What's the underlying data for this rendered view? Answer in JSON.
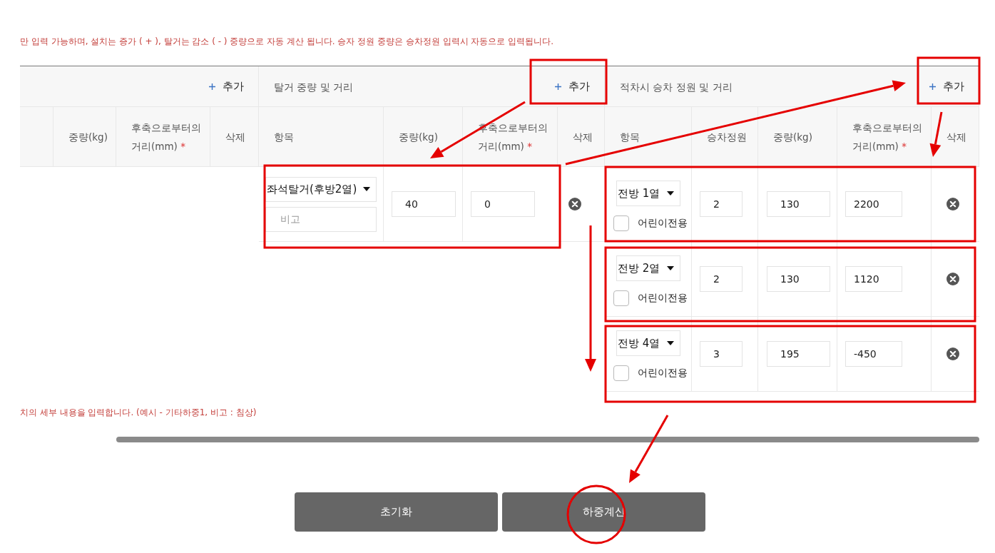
{
  "top_notice": "만 입력 가능하며, 설치는 증가 ( + ), 탈거는 감소 ( - ) 중량으로 자동 계산 됩니다. 승자 정원 중량은 승차정원 입력시 자동으로 입력됩니다.",
  "table": {
    "sections": [
      {
        "kind": "plain",
        "add_button": "추가",
        "columns": [
          {
            "kind": "blank"
          },
          {
            "kind": "text",
            "label": "중량(kg)"
          },
          {
            "kind": "text",
            "label": "후축으로부터의 거리(mm)",
            "mark": "*"
          },
          {
            "kind": "text",
            "label": "삭제"
          }
        ]
      },
      {
        "kind": "removal",
        "title": "탈거 중량 및 거리",
        "add_button": "추가",
        "columns": [
          {
            "kind": "text",
            "label": "항목"
          },
          {
            "kind": "text",
            "label": "중량(kg)"
          },
          {
            "kind": "text",
            "label": "후축으로부터의 거리(mm)",
            "mark": "*"
          },
          {
            "kind": "text",
            "label": "삭제"
          }
        ],
        "rows": [
          {
            "item": "좌석탈거(후방2열)",
            "note_placeholder": "비고",
            "weight": "40",
            "distance": "0"
          }
        ]
      },
      {
        "kind": "passenger",
        "title": "적차시 승차 정원 및 거리",
        "add_button": "추가",
        "columns": [
          {
            "kind": "text",
            "label": "항목"
          },
          {
            "kind": "text",
            "label": "승차정원"
          },
          {
            "kind": "text",
            "label": "중량(kg)"
          },
          {
            "kind": "text",
            "label": "후축으로부터의 거리(mm)",
            "mark": "*"
          },
          {
            "kind": "text",
            "label": "삭제"
          }
        ],
        "rows": [
          {
            "seat": "전방 1열",
            "child_only": {
              "label": "어린이전용",
              "checked": false
            },
            "passengers": "2",
            "weight": "130",
            "distance": "2200"
          },
          {
            "seat": "전방 2열",
            "child_only": {
              "label": "어린이전용",
              "checked": false
            },
            "passengers": "2",
            "weight": "130",
            "distance": "1120"
          },
          {
            "seat": "전방 4열",
            "child_only": {
              "label": "어린이전용",
              "checked": false
            },
            "passengers": "3",
            "weight": "195",
            "distance": "-450"
          }
        ]
      }
    ]
  },
  "bottom_notice": "치의 세부 내용을 입력합니다. (예시 - 기타하중1, 비고 : 침상)",
  "buttons": [
    {
      "label": "초기화"
    },
    {
      "label": "하중계산"
    }
  ]
}
